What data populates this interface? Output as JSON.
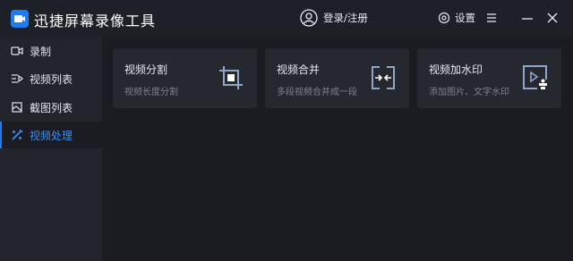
{
  "app": {
    "title": "迅捷屏幕录像工具"
  },
  "header": {
    "login_label": "登录/注册",
    "settings_label": "设置"
  },
  "sidebar": {
    "items": [
      {
        "label": "录制",
        "icon": "record-icon"
      },
      {
        "label": "视频列表",
        "icon": "video-list-icon"
      },
      {
        "label": "截图列表",
        "icon": "screenshot-list-icon"
      },
      {
        "label": "视频处理",
        "icon": "video-process-icon",
        "active": true
      }
    ]
  },
  "cards": [
    {
      "title": "视频分割",
      "desc": "视频长度分割",
      "icon": "crop-icon"
    },
    {
      "title": "视频合并",
      "desc": "多段视频合并成一段",
      "icon": "merge-icon"
    },
    {
      "title": "视频加水印",
      "desc": "添加图片、文字水印",
      "icon": "watermark-icon"
    }
  ],
  "colors": {
    "accent": "#1f7cf0",
    "background": "#1a1c22",
    "sidebar": "#22242b",
    "card": "#262830",
    "icon_stroke": "#8fa6c9"
  }
}
